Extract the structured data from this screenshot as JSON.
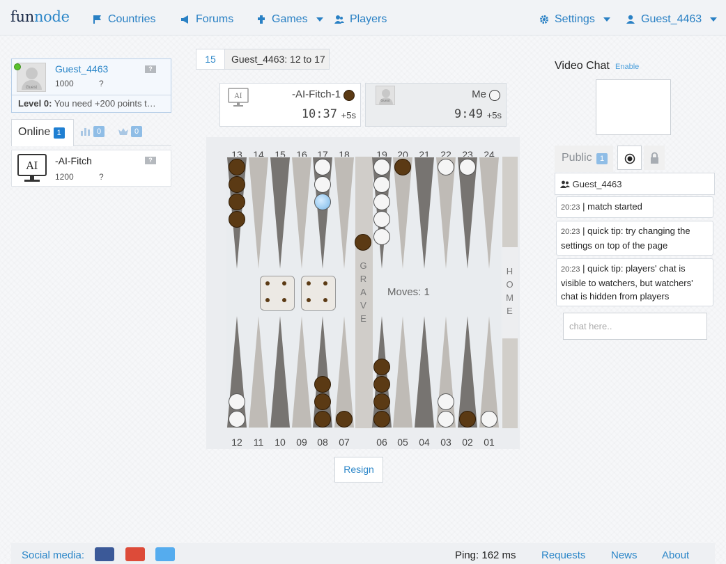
{
  "nav": {
    "logo_a": "fun",
    "logo_b": "node",
    "countries": "Countries",
    "forums": "Forums",
    "games": "Games",
    "players": "Players",
    "settings": "Settings",
    "user": "Guest_4463"
  },
  "me": {
    "name": "Guest_4463",
    "rating": "1000",
    "rank": "?",
    "badge": "?",
    "avatar_caption": "Guest",
    "level_label": "Level 0:",
    "level_text": "You need +200 points t…"
  },
  "left_tabs": {
    "online": "Online",
    "online_count": "1",
    "stats_count": "0",
    "crown_count": "0"
  },
  "online_list": [
    {
      "name": "-AI-Fitch",
      "rating": "1200",
      "rank": "?",
      "badge": "?",
      "avatar": "AI"
    }
  ],
  "match": {
    "round": "15",
    "round_info": "Guest_4463: 12 to 17",
    "opponent": {
      "name": "-AI-Fitch-1",
      "time": "10:37",
      "inc": "+5s",
      "avatar": "AI"
    },
    "self": {
      "name": "Me",
      "time": "9:49",
      "inc": "+5s",
      "avatar_caption": "Guest"
    },
    "moves_label": "Moves: 1",
    "resign": "Resign",
    "grave_letters": [
      "G",
      "R",
      "A",
      "V",
      "E"
    ],
    "home_letters": [
      "H",
      "O",
      "M",
      "E"
    ],
    "top_numbers": [
      "13",
      "14",
      "15",
      "16",
      "17",
      "18",
      "19",
      "20",
      "21",
      "22",
      "23",
      "24"
    ],
    "bottom_numbers": [
      "12",
      "11",
      "10",
      "09",
      "08",
      "07",
      "06",
      "05",
      "04",
      "03",
      "02",
      "01"
    ],
    "dice": [
      4,
      4
    ],
    "points": {
      "13": {
        "color": "black",
        "count": 4
      },
      "17": {
        "color": "white",
        "count": 3,
        "selected_index": 2
      },
      "19": {
        "color": "white",
        "count": 5
      },
      "20": {
        "color": "black",
        "count": 1
      },
      "22": {
        "color": "white",
        "count": 1
      },
      "23": {
        "color": "white",
        "count": 1
      },
      "12": {
        "color": "white",
        "count": 2
      },
      "08": {
        "color": "black",
        "count": 3
      },
      "07": {
        "color": "black",
        "count": 1
      },
      "06": {
        "color": "black",
        "count": 4
      },
      "03": {
        "color": "white",
        "count": 2
      },
      "02": {
        "color": "black",
        "count": 1
      },
      "01": {
        "color": "white",
        "count": 1
      }
    },
    "bar": {
      "color": "black",
      "count": 1
    }
  },
  "video_chat": {
    "title": "Video Chat",
    "enable": "Enable"
  },
  "chat": {
    "tab_public": "Public",
    "public_count": "1",
    "user": "Guest_4463",
    "messages": [
      {
        "time": "20:23",
        "text": "match started"
      },
      {
        "time": "20:23",
        "text": "quick tip: try changing the settings on top of the page"
      },
      {
        "time": "20:23",
        "text": "quick tip: players' chat is visible to watchers, but watchers' chat is hidden from players"
      }
    ],
    "placeholder": "chat here.."
  },
  "footer": {
    "social_label": "Social media:",
    "ping": "Ping: 162 ms",
    "requests": "Requests",
    "news": "News",
    "about": "About"
  },
  "colors": {
    "accent": "#2b86c8",
    "dark_point": "#777471",
    "light_point": "#bfbbb6",
    "black_checker": "#5b3a14"
  }
}
